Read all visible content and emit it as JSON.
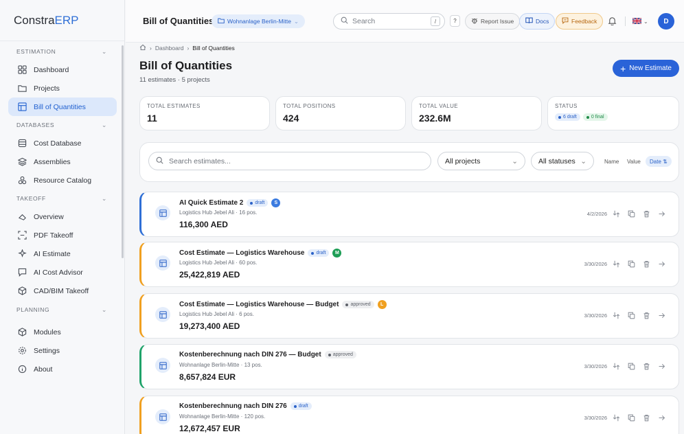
{
  "app": {
    "logo_main": "Constra",
    "logo_accent": "ERP"
  },
  "sidebar": {
    "sections": [
      {
        "title": "ESTIMATION"
      },
      {
        "title": "DATABASES"
      },
      {
        "title": "TAKEOFF"
      },
      {
        "title": "PLANNING"
      }
    ],
    "items": [
      {
        "label": "Dashboard"
      },
      {
        "label": "Projects"
      },
      {
        "label": "Bill of Quantities"
      },
      {
        "label": "Cost Database"
      },
      {
        "label": "Assemblies"
      },
      {
        "label": "Resource Catalog"
      },
      {
        "label": "Overview"
      },
      {
        "label": "PDF Takeoff"
      },
      {
        "label": "AI Estimate"
      },
      {
        "label": "AI Cost Advisor"
      },
      {
        "label": "CAD/BIM Takeoff"
      },
      {
        "label": "Modules"
      },
      {
        "label": "Settings"
      },
      {
        "label": "About"
      }
    ]
  },
  "topbar": {
    "title": "Bill of Quantities",
    "project": "Wohnanlage Berlin-Mitte",
    "search_placeholder": "Search",
    "search_shortcut": "/",
    "help": "?",
    "report_issue": "Report Issue",
    "docs": "Docs",
    "feedback": "Feedback",
    "avatar": "D"
  },
  "breadcrumb": {
    "home": "",
    "dashboard": "Dashboard",
    "current": "Bill of Quantities"
  },
  "page": {
    "title": "Bill of Quantities",
    "subtitle": "11 estimates · 5 projects",
    "new_button": "New Estimate"
  },
  "stats": {
    "total_estimates": {
      "label": "TOTAL ESTIMATES",
      "value": "11"
    },
    "total_positions": {
      "label": "TOTAL POSITIONS",
      "value": "424"
    },
    "total_value": {
      "label": "TOTAL VALUE",
      "value": "232.6M"
    },
    "status": {
      "label": "STATUS",
      "draft": "6 draft",
      "final": "0 final"
    }
  },
  "filters": {
    "search_placeholder": "Search estimates...",
    "projects": "All projects",
    "statuses": "All statuses",
    "sort_name": "Name",
    "sort_value": "Value",
    "sort_date": "Date ⇅"
  },
  "estimates": [
    {
      "title": "AI Quick Estimate 2",
      "status": "draft",
      "initial": "S",
      "initial_color": "#3b7be0",
      "accent": "#2f6fd6",
      "project": "Logistics Hub Jebel Ali",
      "positions": "16 pos.",
      "amount": "116,300 AED",
      "date": "4/2/2026"
    },
    {
      "title": "Cost Estimate — Logistics Warehouse",
      "status": "draft",
      "initial": "M",
      "initial_color": "#1e9e56",
      "accent": "#f0a020",
      "project": "Logistics Hub Jebel Ali",
      "positions": "60 pos.",
      "amount": "25,422,819 AED",
      "date": "3/30/2026"
    },
    {
      "title": "Cost Estimate — Logistics Warehouse — Budget",
      "status": "approved",
      "initial": "L",
      "initial_color": "#f0a020",
      "accent": "#f0a020",
      "project": "Logistics Hub Jebel Ali",
      "positions": "6 pos.",
      "amount": "19,273,400 AED",
      "date": "3/30/2026"
    },
    {
      "title": "Kostenberechnung nach DIN 276 — Budget",
      "status": "approved",
      "initial": "",
      "initial_color": "",
      "accent": "#1fa36a",
      "project": "Wohnanlage Berlin-Mitte",
      "positions": "13 pos.",
      "amount": "8,657,824 EUR",
      "date": "3/30/2026"
    },
    {
      "title": "Kostenberechnung nach DIN 276",
      "status": "draft",
      "initial": "",
      "initial_color": "",
      "accent": "#f0a020",
      "project": "Wohnanlage Berlin-Mitte",
      "positions": "120 pos.",
      "amount": "12,672,457 EUR",
      "date": "3/30/2026"
    }
  ]
}
